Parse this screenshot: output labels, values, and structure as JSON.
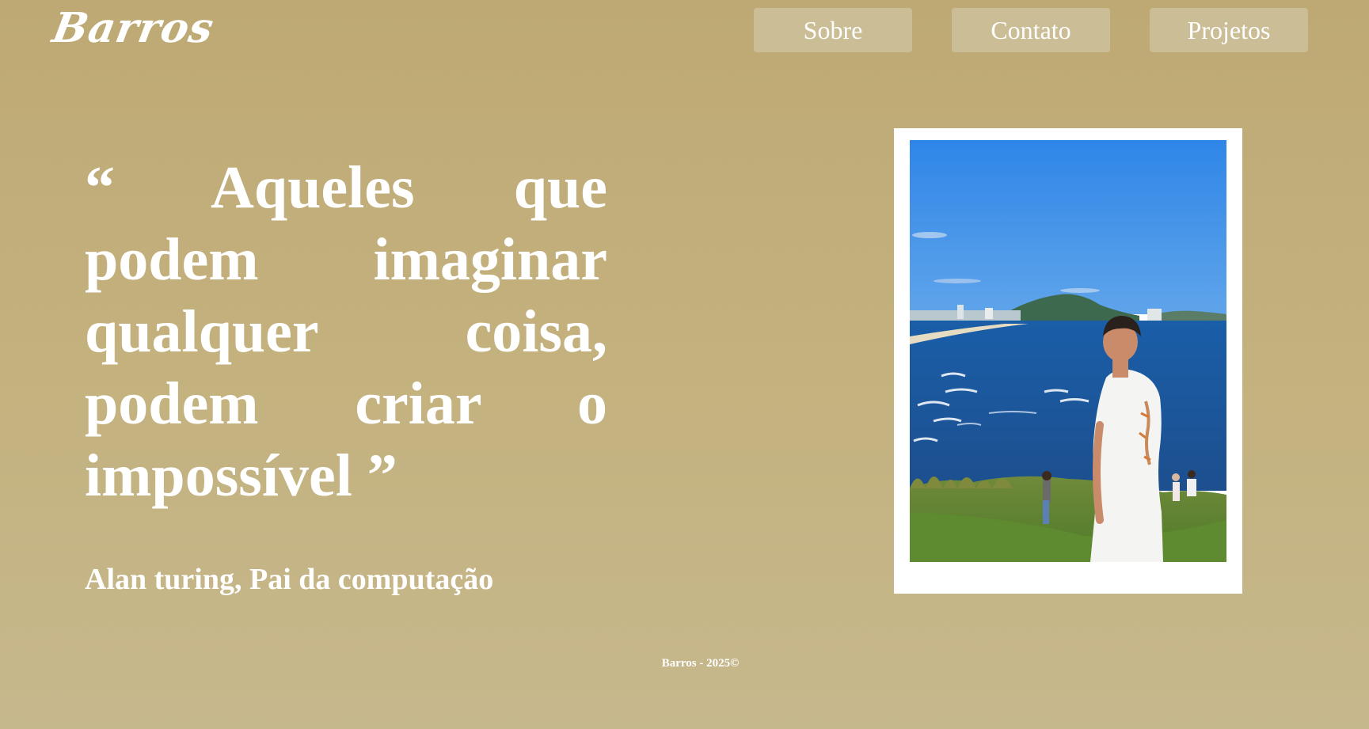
{
  "logo": {
    "text": "Barros"
  },
  "nav": [
    {
      "label": "Sobre"
    },
    {
      "label": "Contato"
    },
    {
      "label": "Projetos"
    }
  ],
  "quote": {
    "text": "“ Aqueles que podem imaginar qualquer coisa, podem criar o impossível ”",
    "author": "Alan turing, Pai da computação"
  },
  "footer": {
    "text": "Barros - 2025©"
  },
  "colors": {
    "background": "#bea974",
    "nav_button": "#cbbd95",
    "text": "#ffffff",
    "photo_frame": "#ffffff"
  }
}
